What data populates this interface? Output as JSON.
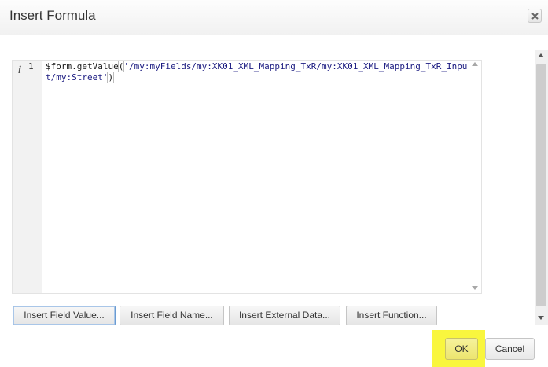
{
  "dialog": {
    "title": "Insert Formula",
    "close_icon": "close-x-icon"
  },
  "editor": {
    "info_glyph": "i",
    "line_number": "1",
    "code_prefix": "$form.getValue",
    "code_open_paren": "(",
    "code_string": "'/my:myFields/my:XK01_XML_Mapping_TxR/my:XK01_XML_Mapping_TxR_Input/my:Street'",
    "code_close_paren": ")"
  },
  "buttons": {
    "insert_field_value": "Insert Field Value...",
    "insert_field_name": "Insert Field Name...",
    "insert_external_data": "Insert External Data...",
    "insert_function": "Insert Function...",
    "ok": "OK",
    "cancel": "Cancel"
  },
  "colors": {
    "highlight": "#f9f63e",
    "focus_border": "#6a9bd1"
  }
}
